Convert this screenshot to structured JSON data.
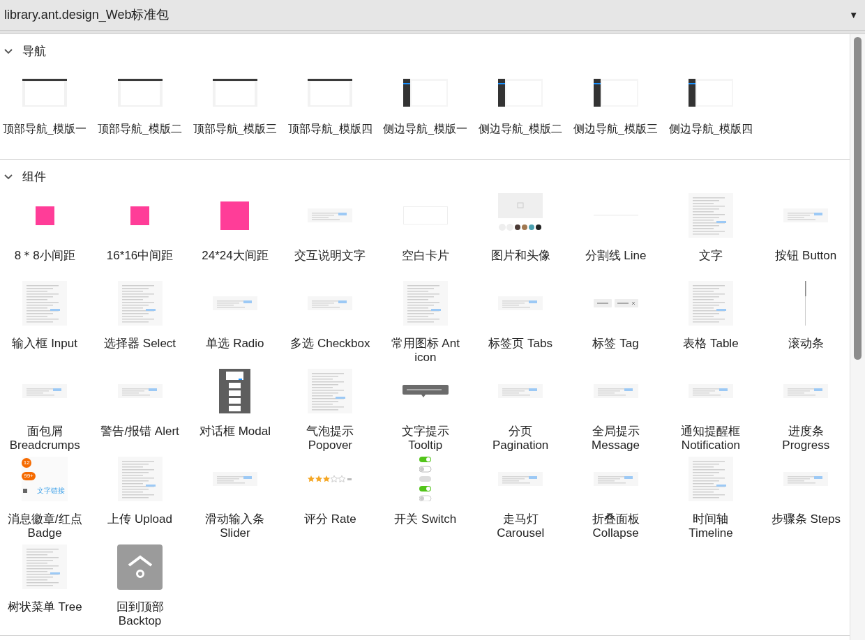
{
  "library_select": {
    "value": "library.ant.design_Web标准包",
    "caret": "▼"
  },
  "sections": [
    {
      "title": "导航",
      "expanded": true,
      "items": [
        {
          "label": "顶部导航_模版一",
          "kind": "screen-top"
        },
        {
          "label": "顶部导航_模版二",
          "kind": "screen-top"
        },
        {
          "label": "顶部导航_模版三",
          "kind": "screen-top"
        },
        {
          "label": "顶部导航_模版四",
          "kind": "screen-top"
        },
        {
          "label": "侧边导航_模版一",
          "kind": "screen-side"
        },
        {
          "label": "侧边导航_模版二",
          "kind": "screen-side"
        },
        {
          "label": "侧边导航_模版三",
          "kind": "screen-side"
        },
        {
          "label": "侧边导航_模版四",
          "kind": "screen-side"
        }
      ]
    },
    {
      "title": "组件",
      "expanded": true,
      "items": [
        {
          "label": "8＊8小间距",
          "kind": "spacer"
        },
        {
          "label": "16*16中间距",
          "kind": "spacer"
        },
        {
          "label": "24*24大间距",
          "kind": "spacer-large"
        },
        {
          "label": "交互说明文字",
          "kind": "strip"
        },
        {
          "label": "空白卡片",
          "kind": "blank"
        },
        {
          "label": "图片和头像",
          "kind": "avatars"
        },
        {
          "label": "分割线 Line",
          "kind": "line"
        },
        {
          "label": "文字",
          "kind": "page"
        },
        {
          "label": "按钮 Button",
          "kind": "strip"
        },
        {
          "label": "输入框 Input",
          "kind": "page"
        },
        {
          "label": "选择器 Select",
          "kind": "page"
        },
        {
          "label": "单选 Radio",
          "kind": "strip"
        },
        {
          "label": "多选 Checkbox",
          "kind": "strip"
        },
        {
          "label": "常用图标 Ant\nicon",
          "kind": "page"
        },
        {
          "label": "标签页 Tabs",
          "kind": "strip"
        },
        {
          "label": "标签 Tag",
          "kind": "tags"
        },
        {
          "label": "表格 Table",
          "kind": "page"
        },
        {
          "label": "滚动条",
          "kind": "scroll"
        },
        {
          "label": "面包屑\nBreadcrumps",
          "kind": "strip"
        },
        {
          "label": "警告/报错 Alert",
          "kind": "strip"
        },
        {
          "label": "对话框 Modal",
          "kind": "modal"
        },
        {
          "label": "气泡提示\nPopover",
          "kind": "page"
        },
        {
          "label": "文字提示\nTooltip",
          "kind": "tooltip"
        },
        {
          "label": "分页\nPagination",
          "kind": "strip"
        },
        {
          "label": "全局提示\nMessage",
          "kind": "strip"
        },
        {
          "label": "通知提醒框\nNotification",
          "kind": "strip"
        },
        {
          "label": "进度条\nProgress",
          "kind": "strip"
        },
        {
          "label": "消息徽章/红点\nBadge",
          "kind": "badge",
          "thumb_texts": [
            "12",
            "99+",
            "文字链接"
          ]
        },
        {
          "label": "上传 Upload",
          "kind": "page"
        },
        {
          "label": "滑动输入条\nSlider",
          "kind": "strip"
        },
        {
          "label": "评分 Rate",
          "kind": "rate"
        },
        {
          "label": "开关 Switch",
          "kind": "switches"
        },
        {
          "label": "走马灯\nCarousel",
          "kind": "strip"
        },
        {
          "label": "折叠面板\nCollapse",
          "kind": "strip"
        },
        {
          "label": "时间轴\nTimeline",
          "kind": "page"
        },
        {
          "label": "步骤条 Steps",
          "kind": "strip"
        },
        {
          "label": "树状菜单 Tree",
          "kind": "page"
        },
        {
          "label": "回到顶部\nBacktop",
          "kind": "backtop"
        }
      ]
    }
  ]
}
